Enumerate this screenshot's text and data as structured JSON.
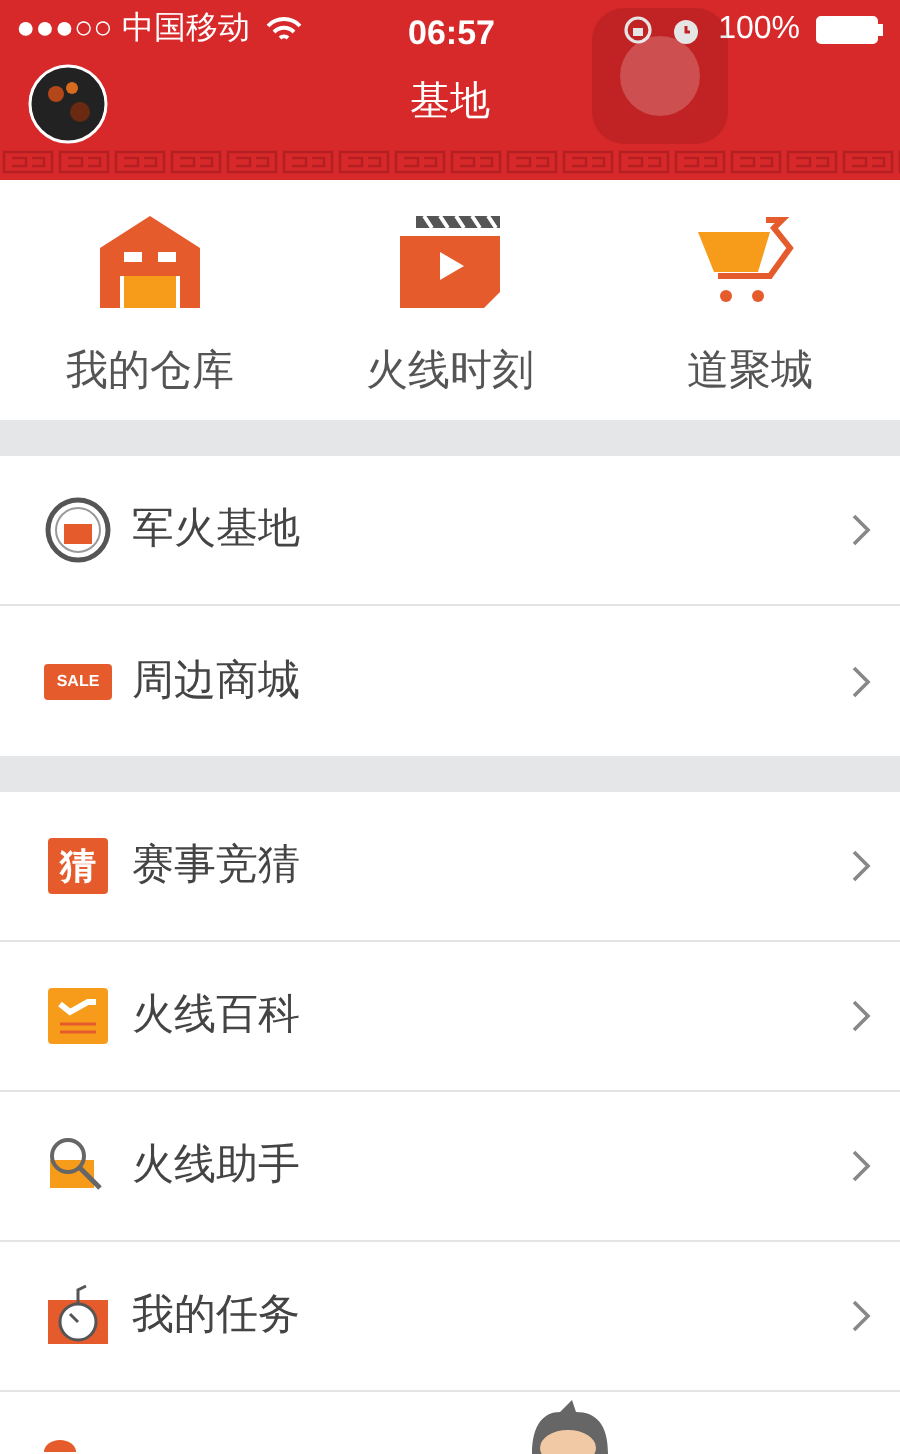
{
  "status_bar": {
    "carrier": "●●●○○ 中国移动",
    "time": "06:57",
    "battery": "100%"
  },
  "header": {
    "title": "基地"
  },
  "shortcuts": [
    {
      "label": "我的仓库",
      "kind": "warehouse"
    },
    {
      "label": "火线时刻",
      "kind": "video"
    },
    {
      "label": "道聚城",
      "kind": "cart"
    }
  ],
  "groups": [
    [
      {
        "label": "军火基地",
        "kind": "badge"
      },
      {
        "label": "周边商城",
        "kind": "sale",
        "icon_text": "SALE"
      }
    ],
    [
      {
        "label": "赛事竞猜",
        "kind": "guess",
        "icon_text": "猜"
      },
      {
        "label": "火线百科",
        "kind": "wiki"
      },
      {
        "label": "火线助手",
        "kind": "helper"
      },
      {
        "label": "我的任务",
        "kind": "task"
      },
      {
        "kind": "partial"
      }
    ]
  ]
}
